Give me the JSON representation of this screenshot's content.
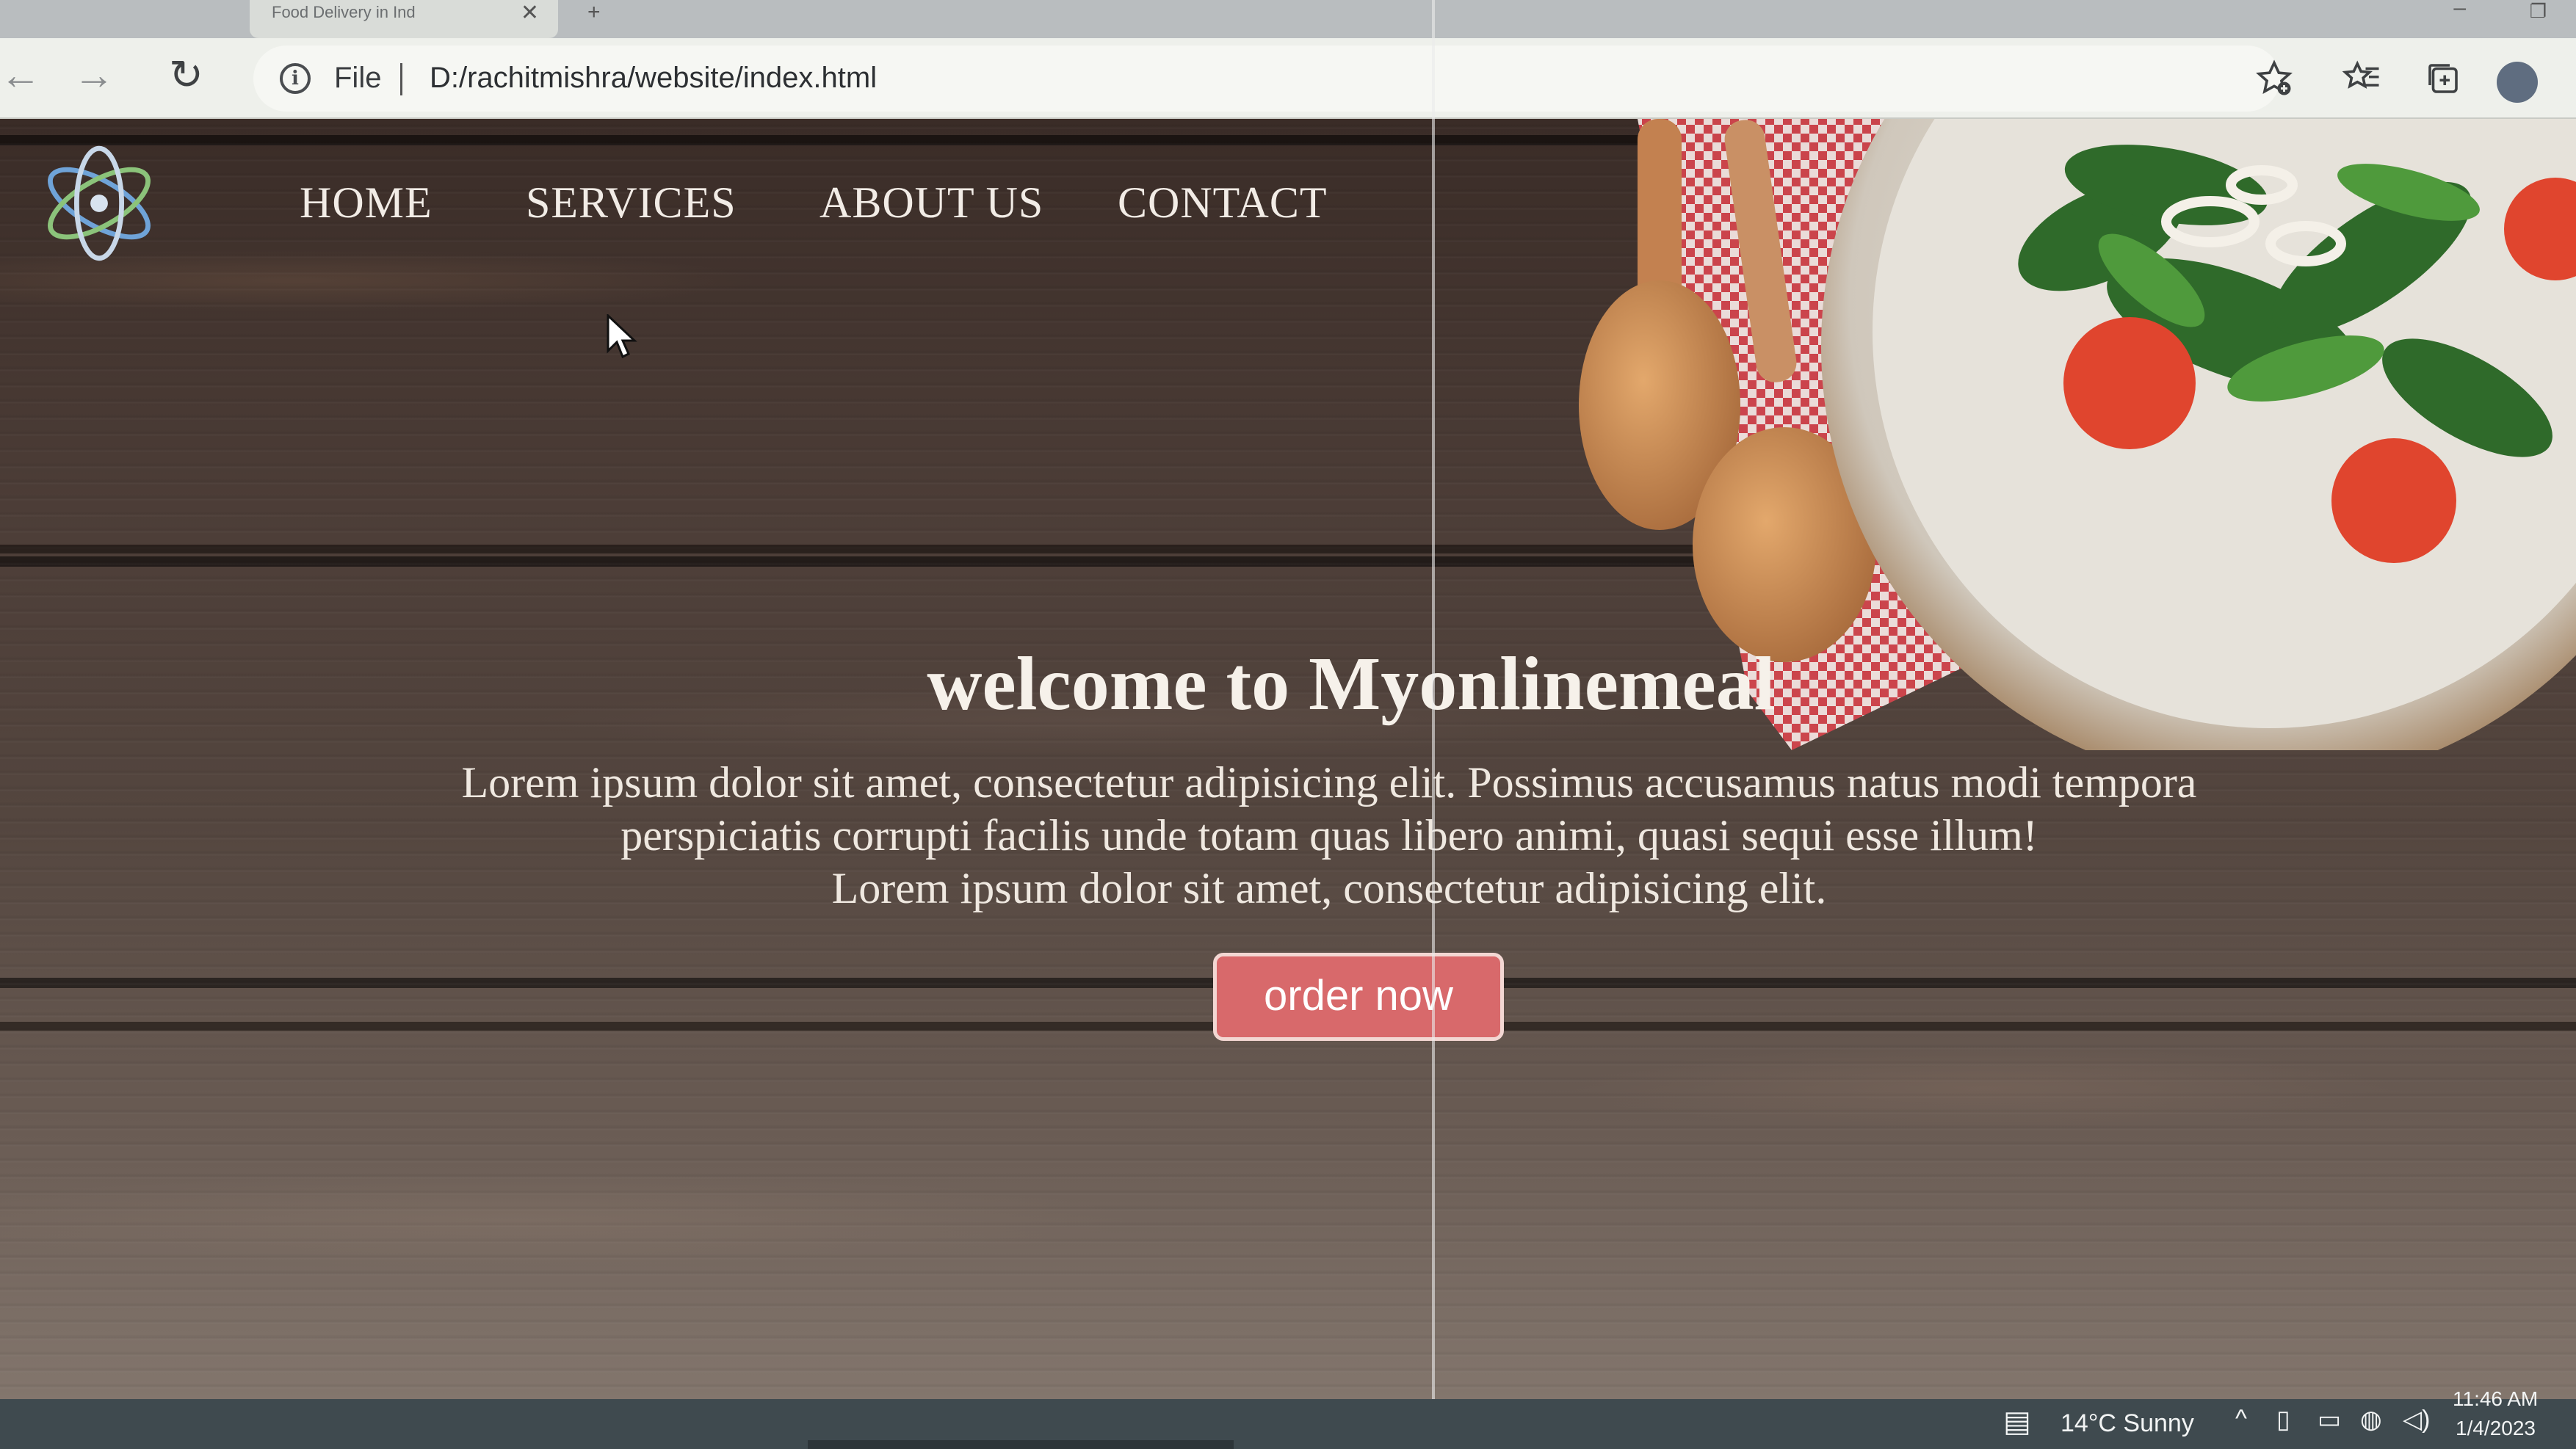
{
  "browser": {
    "tab_title": "Food Delivery in Ind",
    "address": {
      "scheme_label": "File",
      "url": "D:/rachitmishra/website/index.html"
    },
    "icons": [
      "back-icon",
      "forward-icon",
      "reload-icon",
      "info-icon",
      "add-favorite-icon",
      "favorites-icon",
      "collections-icon",
      "profile-icon"
    ]
  },
  "site": {
    "nav": [
      {
        "label": "HOME"
      },
      {
        "label": "SERVICES"
      },
      {
        "label": "ABOUT US"
      },
      {
        "label": "CONTACT"
      }
    ],
    "hero": {
      "title": "welcome to Myonlinemeal",
      "lines": [
        "Lorem ipsum dolor sit amet, consectetur adipisicing elit. Possimus accusamus natus modi tempora",
        "perspiciatis corrupti facilis unde totam quas libero animi, quasi sequi esse illum!",
        "Lorem ipsum dolor sit amet, consectetur adipisicing elit."
      ],
      "button_label": "order now"
    },
    "colors": {
      "button": "#d8696b",
      "wood": "#4c3d37",
      "text": "#f2ece6"
    }
  },
  "taskbar": {
    "weather": "14°C  Sunny",
    "time": "11:46 AM",
    "date": "1/4/2023"
  }
}
